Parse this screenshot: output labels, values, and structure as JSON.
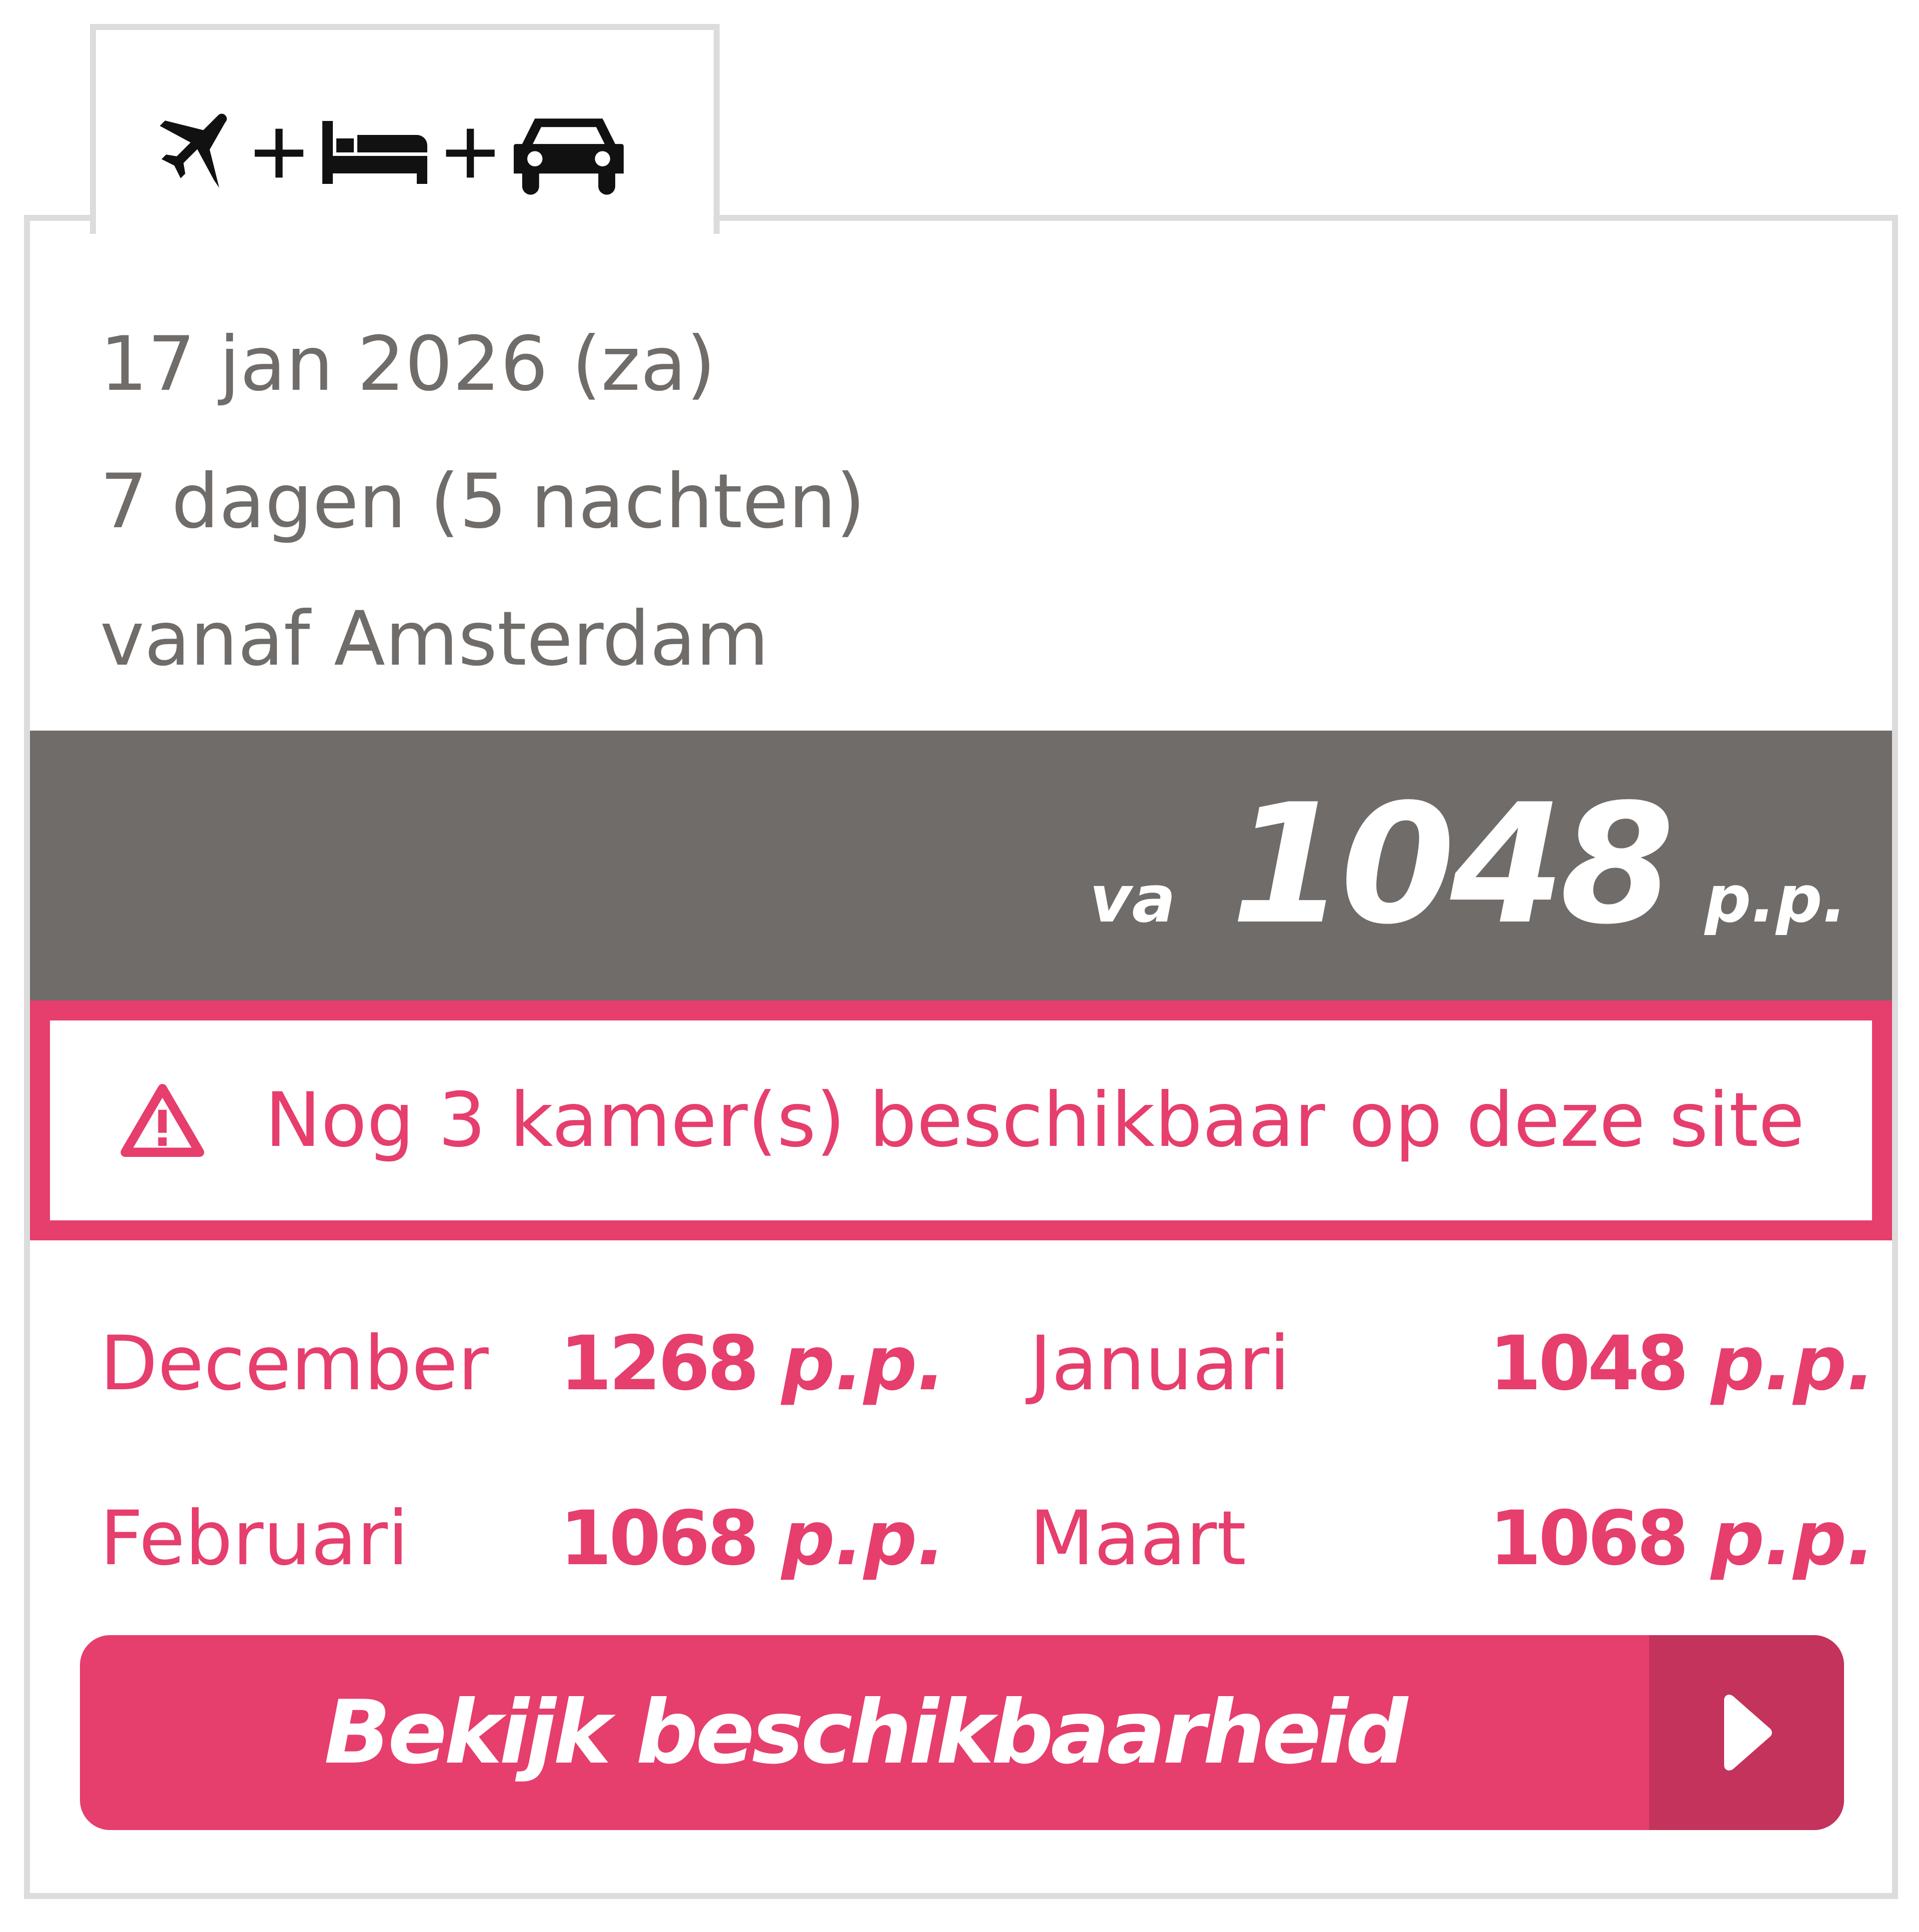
{
  "tab": {
    "icons": [
      "plane-icon",
      "bed-icon",
      "car-icon"
    ],
    "plus": "+"
  },
  "details": {
    "date": "17 jan 2026 (za)",
    "duration": "7 dagen (5 nachten)",
    "departure": "vanaf Amsterdam"
  },
  "price": {
    "prefix": "va",
    "amount": "1048",
    "suffix": "p.p."
  },
  "alert": {
    "icon": "warning-icon",
    "message": "Nog 3 kamer(s) beschikbaar op deze site"
  },
  "months": [
    {
      "name": "December",
      "price": "1268",
      "suffix": "p.p."
    },
    {
      "name": "Januari",
      "price": "1048",
      "suffix": "p.p."
    },
    {
      "name": "Februari",
      "price": "1068",
      "suffix": "p.p."
    },
    {
      "name": "Maart",
      "price": "1068",
      "suffix": "p.p."
    }
  ],
  "cta": {
    "label": "Bekijk beschikbaarheid",
    "icon": "chevron-right-icon"
  },
  "colors": {
    "accent": "#e63e6d",
    "accent_dark": "#c3335c",
    "price_bar": "#706c69",
    "text_grey": "#6f6c69",
    "border": "#dcdcdc"
  }
}
